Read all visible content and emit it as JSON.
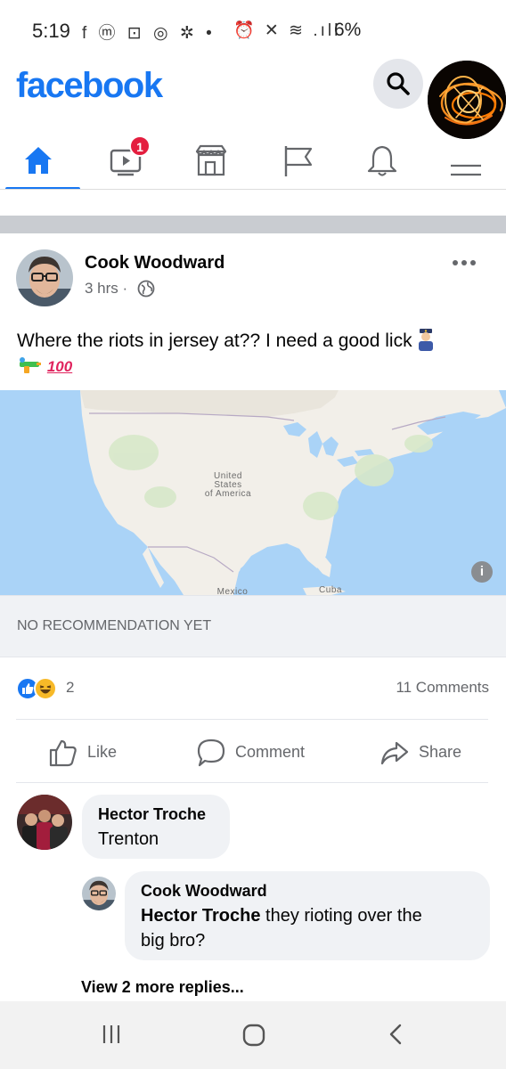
{
  "status_bar": {
    "time": "5:19",
    "left_icons": "f ⓜ ⊡ ◎ ✲ •",
    "right_icons": "⏰ ✕ ≋ .ıll",
    "battery": "6%"
  },
  "header": {
    "logo": "facebook",
    "notifications_badge": "1",
    "nav_items": [
      "home-icon",
      "watch-icon",
      "marketplace-icon",
      "pages-icon",
      "notifications-icon",
      "menu-icon"
    ],
    "brand_color": "#1877f2"
  },
  "post": {
    "author": "Cook Woodward",
    "time": "3 hrs",
    "separator": "·",
    "text_line": "Where the riots in jersey at?? I need a good lick",
    "emoji_100": "100",
    "map_labels": {
      "country": [
        "United",
        "States",
        "of America"
      ],
      "mexico": "Mexico",
      "cuba": "Cuba",
      "info": "i"
    },
    "recommendation": "NO RECOMMENDATION YET",
    "reaction_count": "2",
    "comments_count": "11 Comments",
    "actions": {
      "like": "Like",
      "comment": "Comment",
      "share": "Share"
    }
  },
  "comments": [
    {
      "name": "Hector Troche",
      "text": "Trenton"
    },
    {
      "name": "Cook Woodward",
      "mention": "Hector Troche",
      "text_line1": " they rioting over the",
      "text_line2": "big bro?"
    }
  ],
  "view_more_replies": "View 2 more replies..."
}
